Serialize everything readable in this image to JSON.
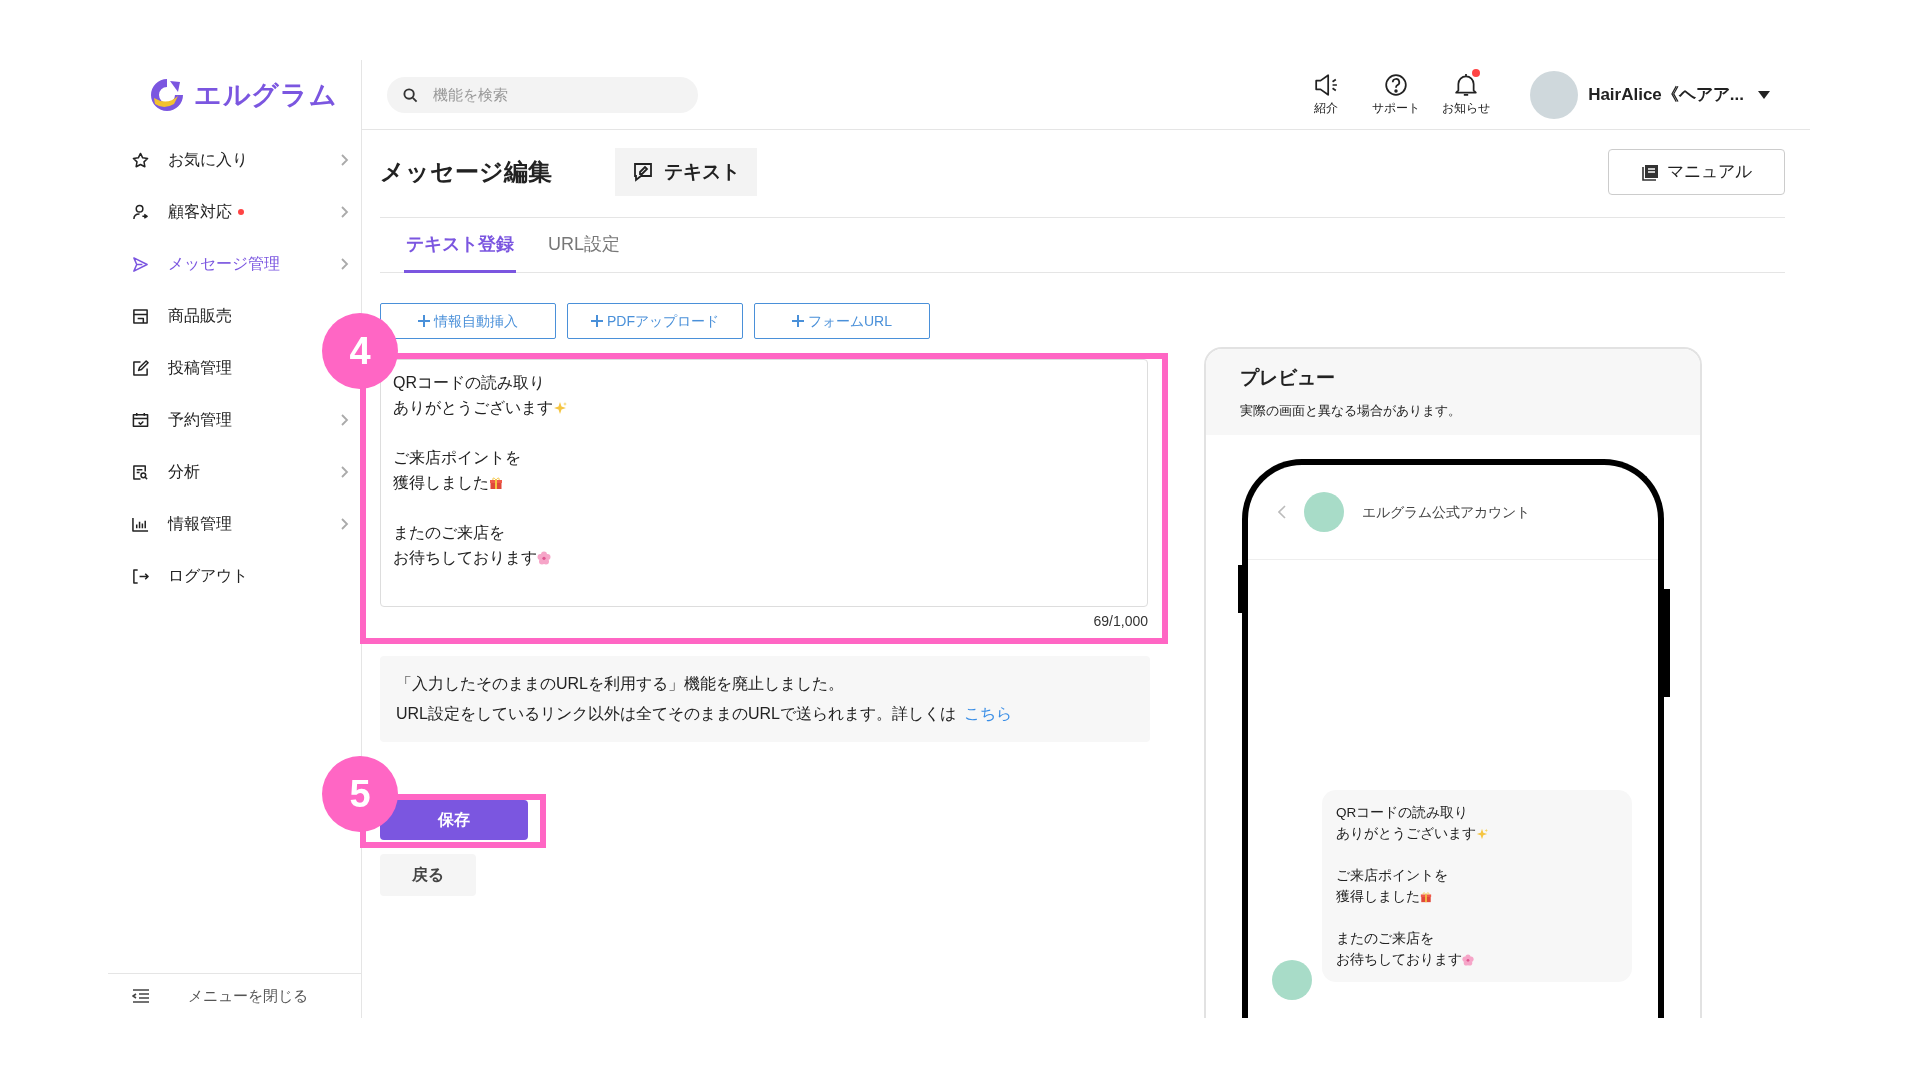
{
  "logo": {
    "text": "エルグラム"
  },
  "sidebar": {
    "items": [
      {
        "label": "お気に入り",
        "kind": "star",
        "selected": false,
        "dot": false,
        "chevron": true
      },
      {
        "label": "顧客対応",
        "kind": "person",
        "selected": false,
        "dot": true,
        "chevron": true
      },
      {
        "label": "メッセージ管理",
        "kind": "send",
        "selected": true,
        "dot": false,
        "chevron": true
      },
      {
        "label": "商品販売",
        "kind": "shop",
        "selected": false,
        "dot": false,
        "chevron": false
      },
      {
        "label": "投稿管理",
        "kind": "edit",
        "selected": false,
        "dot": false,
        "chevron": false
      },
      {
        "label": "予約管理",
        "kind": "calendar",
        "selected": false,
        "dot": false,
        "chevron": true
      },
      {
        "label": "分析",
        "kind": "report",
        "selected": false,
        "dot": false,
        "chevron": true
      },
      {
        "label": "情報管理",
        "kind": "chart",
        "selected": false,
        "dot": false,
        "chevron": true
      },
      {
        "label": "ログアウト",
        "kind": "logout",
        "selected": false,
        "dot": false,
        "chevron": false
      }
    ],
    "collapse": "メニューを閉じる"
  },
  "header": {
    "search": {
      "placeholder": "機能を検索"
    },
    "nav": [
      {
        "kind": "megaphone",
        "label": "紹介",
        "dot": false
      },
      {
        "kind": "help",
        "label": "サポート",
        "dot": false
      },
      {
        "kind": "bell",
        "label": "お知らせ",
        "dot": true
      }
    ],
    "user": {
      "name": "HairAlice《ヘアア..."
    }
  },
  "page": {
    "title": "メッセージ編集",
    "type_chip": "テキスト",
    "manual_button": "マニュアル",
    "tabs": [
      {
        "label": "テキスト登録",
        "selected": true
      },
      {
        "label": "URL設定",
        "selected": false
      }
    ],
    "insert_buttons": [
      "情報自動挿入",
      "PDFアップロード",
      "フォームURL"
    ],
    "message": [
      {
        "lines": [
          "QRコードの読み取り",
          "ありがとうございます"
        ],
        "kind": "sparkles"
      },
      {
        "lines": [
          "ご来店ポイントを",
          "獲得しました"
        ],
        "kind": "gift"
      },
      {
        "lines": [
          "またのご来店を",
          "お待ちしております"
        ],
        "kind": "flower"
      }
    ],
    "counter": "69/1,000",
    "notice": {
      "line_1": "「入力したそのままのURLを利用する」機能を廃止しました。",
      "line_2": "URL設定をしているリンク以外は全てそのままのURLで送られます。詳しくは",
      "link": "こちら"
    },
    "save_button": "保存",
    "back_button": "戻る",
    "annotations": [
      {
        "number": "4"
      },
      {
        "number": "5"
      }
    ]
  },
  "preview": {
    "title": "プレビュー",
    "note": "実際の画面と異なる場合があります。",
    "account": "エルグラム公式アカウント",
    "bubble": [
      {
        "lines": [
          "QRコードの読み取り",
          "ありがとうございます"
        ],
        "kind": "sparkles"
      },
      {
        "lines": [
          "ご来店ポイントを",
          "獲得しました"
        ],
        "kind": "gift"
      },
      {
        "lines": [
          "またのご来店を",
          "お待ちしております"
        ],
        "kind": "flower"
      }
    ]
  }
}
